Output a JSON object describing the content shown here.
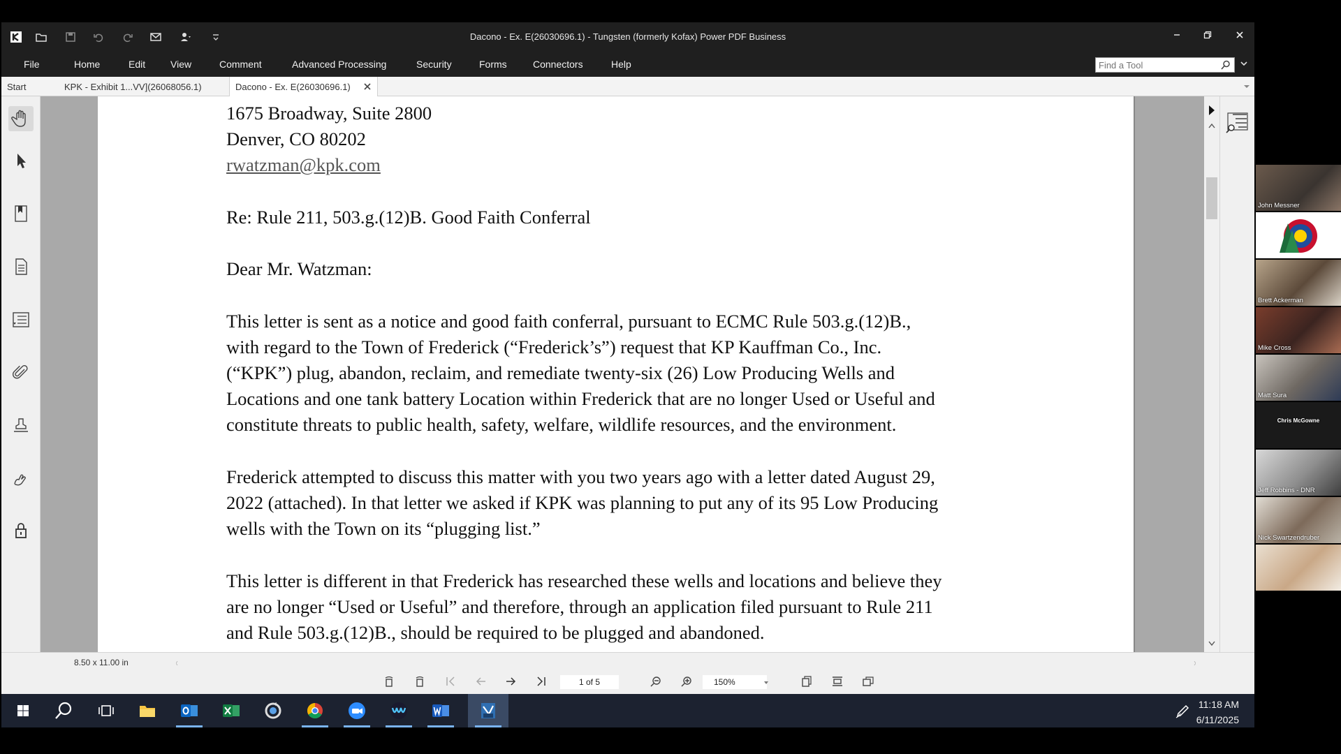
{
  "window": {
    "title": "Dacono - Ex. E(26030696.1) - Tungsten (formerly Kofax) Power PDF Business"
  },
  "menu": {
    "items": [
      "File",
      "Home",
      "Edit",
      "View",
      "Comment",
      "Advanced Processing",
      "Security",
      "Forms",
      "Connectors",
      "Help"
    ],
    "find_placeholder": "Find a Tool"
  },
  "tabs": {
    "start": "Start",
    "items": [
      {
        "label": "KPK - Exhibit 1...VV](26068056.1)",
        "active": false
      },
      {
        "label": "Dacono - Ex. E(26030696.1)",
        "active": true
      }
    ]
  },
  "document": {
    "address_line": "1675 Broadway, Suite 2800",
    "city_line": "Denver, CO 80202",
    "email": "rwatzman@kpk.com",
    "re_line": "Re: Rule 211, 503.g.(12)B. Good Faith Conferral",
    "salutation": "Dear Mr. Watzman:",
    "paragraphs": [
      [
        "This letter is sent as a notice and good faith conferral, pursuant to ECMC Rule 503.g.(12)B.,",
        "with regard to the Town of Frederick (“Frederick’s”) request that KP Kauffman Co., Inc.",
        "(“KPK”) plug, abandon, reclaim, and remediate twenty-six (26) Low Producing Wells and",
        "Locations and one tank battery Location within Frederick that are no longer Used or Useful and",
        "constitute threats to public health, safety, welfare, wildlife resources, and the environment."
      ],
      [
        "Frederick attempted to discuss this matter with you two years ago with a letter dated August 29,",
        "2022 (attached).  In that letter we asked if KPK was planning to put any of its 95 Low Producing",
        "wells with the Town on its “plugging list.”"
      ],
      [
        "This letter is different in that Frederick has researched these wells and locations and believe they",
        "are no longer “Used or Useful” and therefore, through an application filed pursuant to Rule 211",
        "and Rule 503.g.(12)B., should be required to be plugged and abandoned."
      ]
    ]
  },
  "status": {
    "page_size": "8.50 x 11.00 in",
    "page_indicator": "1 of 5",
    "zoom": "150%"
  },
  "taskbar": {
    "time": "11:18 AM",
    "date": "6/11/2025"
  },
  "participants": [
    {
      "name": "John Messner"
    },
    {
      "name": ""
    },
    {
      "name": "Brett Ackerman"
    },
    {
      "name": "Mike Cross"
    },
    {
      "name": "Matt Sura"
    },
    {
      "name": "Chris McGowne"
    },
    {
      "name": "Jeff Robbins - DNR"
    },
    {
      "name": "Nick Swartzendruber"
    },
    {
      "name": ""
    }
  ],
  "colors": {
    "chrome_dark": "#1f1f1f",
    "doc_background": "#a9a9a9",
    "taskbar": "#1c2230"
  }
}
